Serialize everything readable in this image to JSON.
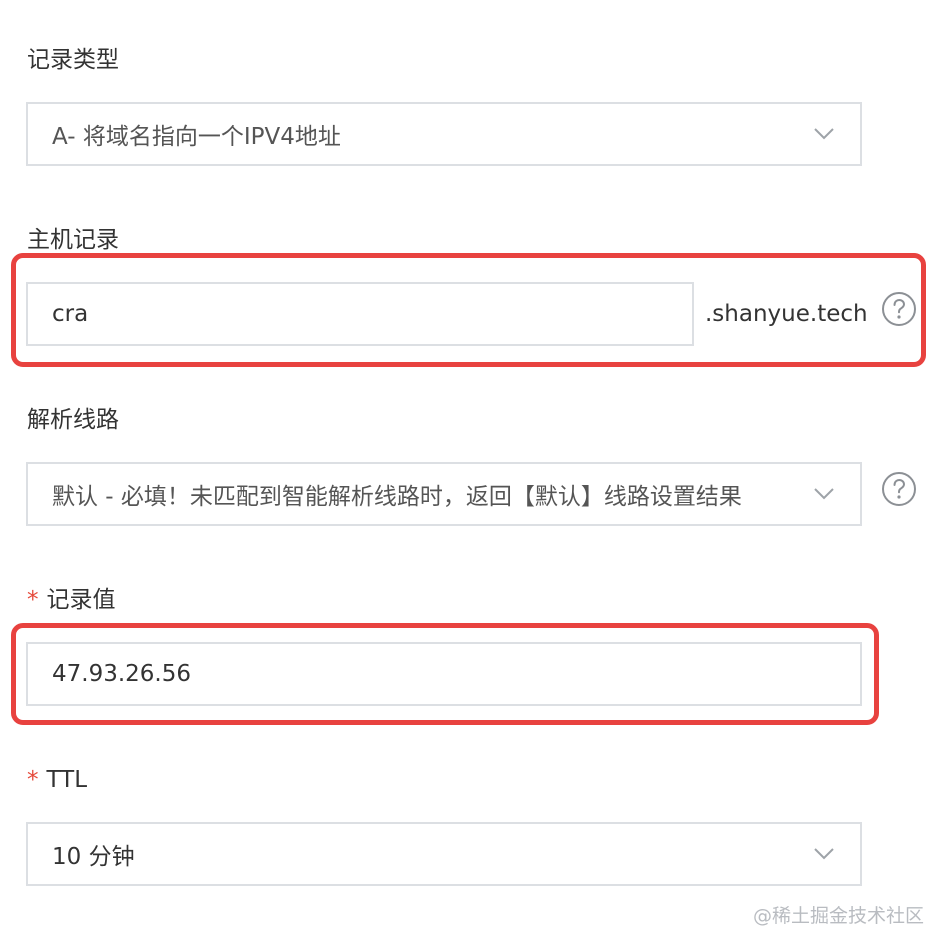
{
  "form": {
    "record_type": {
      "label": "记录类型",
      "value": "A- 将域名指向一个IPV4地址"
    },
    "host_record": {
      "label": "主机记录",
      "value": "cra",
      "suffix": ".shanyue.tech"
    },
    "resolve_line": {
      "label": "解析线路",
      "value": "默认 - 必填！未匹配到智能解析线路时，返回【默认】线路设置结果"
    },
    "record_value": {
      "required_mark": "*",
      "label": "记录值",
      "value": "47.93.26.56"
    },
    "ttl": {
      "required_mark": "*",
      "label": "TTL",
      "value": "10 分钟"
    }
  },
  "watermark": "@稀土掘金技术社区",
  "colors": {
    "highlight": "#e8423f",
    "required": "#e5493a",
    "border": "#dcdfe3"
  }
}
